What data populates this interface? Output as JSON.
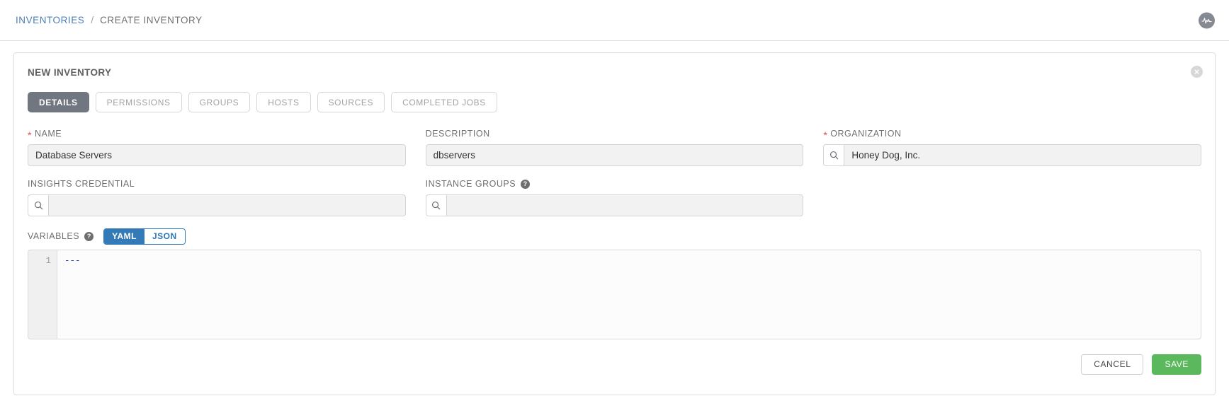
{
  "breadcrumb": {
    "root_label": "INVENTORIES",
    "separator": "/",
    "current_label": "CREATE INVENTORY",
    "activity_icon": "activity-pulse-icon"
  },
  "card": {
    "title": "NEW INVENTORY",
    "close_icon": "close-icon"
  },
  "tabs": [
    {
      "label": "DETAILS",
      "active": true
    },
    {
      "label": "PERMISSIONS",
      "active": false
    },
    {
      "label": "GROUPS",
      "active": false
    },
    {
      "label": "HOSTS",
      "active": false
    },
    {
      "label": "SOURCES",
      "active": false
    },
    {
      "label": "COMPLETED JOBS",
      "active": false
    }
  ],
  "form": {
    "name": {
      "label": "NAME",
      "required": true,
      "value": "Database Servers",
      "placeholder": ""
    },
    "description": {
      "label": "DESCRIPTION",
      "required": false,
      "value": "dbservers",
      "placeholder": ""
    },
    "organization": {
      "label": "ORGANIZATION",
      "required": true,
      "value": "Honey Dog, Inc.",
      "placeholder": "",
      "search_icon": "search-icon"
    },
    "insights_credential": {
      "label": "INSIGHTS CREDENTIAL",
      "required": false,
      "value": "",
      "placeholder": "",
      "search_icon": "search-icon"
    },
    "instance_groups": {
      "label": "INSTANCE GROUPS",
      "required": false,
      "value": "",
      "placeholder": "",
      "help_icon": "help-circle-icon",
      "search_icon": "search-icon"
    }
  },
  "variables": {
    "label": "VARIABLES",
    "help_icon": "help-circle-icon",
    "format_options": [
      {
        "label": "YAML",
        "active": true
      },
      {
        "label": "JSON",
        "active": false
      }
    ],
    "line_numbers": "1",
    "content": "---"
  },
  "footer": {
    "cancel_label": "CANCEL",
    "save_label": "SAVE"
  },
  "colors": {
    "link_blue": "#4a7fb5",
    "accent_blue": "#337ab7",
    "save_green": "#5cb85c",
    "required_red": "#d9534f",
    "tab_active_gray": "#707780",
    "input_bg": "#f2f2f2"
  }
}
